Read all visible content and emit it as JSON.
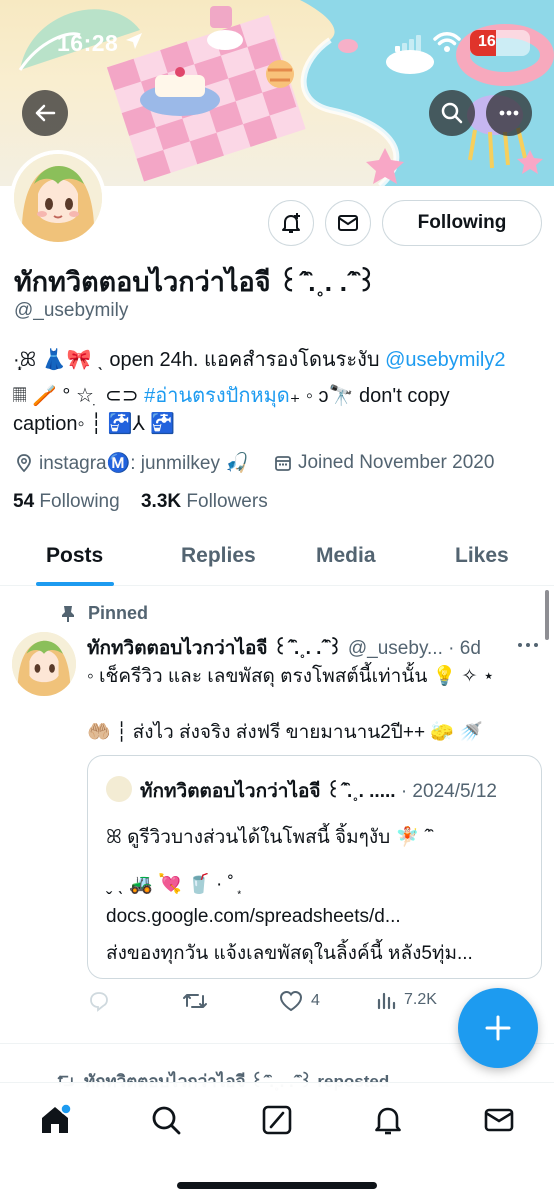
{
  "status_bar": {
    "time": "16:28",
    "battery": "16"
  },
  "profile": {
    "display_name": "ทักทวิตตอบไวกว่าไอจี ꒰ˆ̑.˳. .ˆ̑꒱",
    "handle": "@_usebymily",
    "bio_line1_text": "·̩͙ꕤ 👗🎀 ˎ open 24h. แอคสำรองโดนระงับ ",
    "bio_line1_link": "@usebymily2",
    "bio_line2_text": "𝄜 🪥 ° ☆ ִ ⊂⊃ ",
    "bio_line2_link": "#อ่านตรงปักหมุด",
    "bio_line2_rest": "₊ ◦ ↄ🔭 don't copy",
    "bio_line3": "caption◦ ┆ 🚰⅄ 🚰",
    "location": "instagraⓂ️: junmilkey 🎣",
    "joined": "Joined November 2020",
    "following_count": "54",
    "following_label": "Following",
    "followers_count": "3.3K",
    "followers_label": "Followers",
    "follow_button": "Following"
  },
  "tabs": [
    "Posts",
    "Replies",
    "Media",
    "Likes"
  ],
  "pinned_label": "Pinned",
  "tweet": {
    "author": "ทักทวิตตอบไวกว่าไอจี ꒰ˆ̑.˳. .ˆ̑꒱",
    "handle_time": " @_useby... · 6d",
    "line1": "◦ เช็ครีวิว และ เลขพัสดุ ตรงโพสต์นี้เท่านั้น 💡 ✧ ⋆",
    "line2": "🤲🏼 ┆ ส่งไว ส่งจริง ส่งฟรี ขายมานาน2ปี++ 🧽 🚿",
    "quote": {
      "author": "ทักทวิตตอบไวกว่าไอจี ꒰ˆ̑.˳. .....",
      "date": " · 2024/5/12",
      "line1": "ꕤ ดูรีวิวบางส่วนได้ในโพสนี้ จิ้มๆงับ 🧚🏻 ˆ̑",
      "line2": "ˬ ˎ 🚜 💘 🥤 · ˚ ͙",
      "line3": "docs.google.com/spreadsheets/d...",
      "line4": "ส่งของทุกวัน แจ้งเลขพัสดุในลิ้งค์นี้ หลัง5ทุ่ม..."
    },
    "likes": "4",
    "views": "7.2K"
  },
  "next_tweet_header": "ทักทวิตตอบไวกว่าไอจี ꒰ˆ̑.˳. .ˆ̑꒱ reposted"
}
